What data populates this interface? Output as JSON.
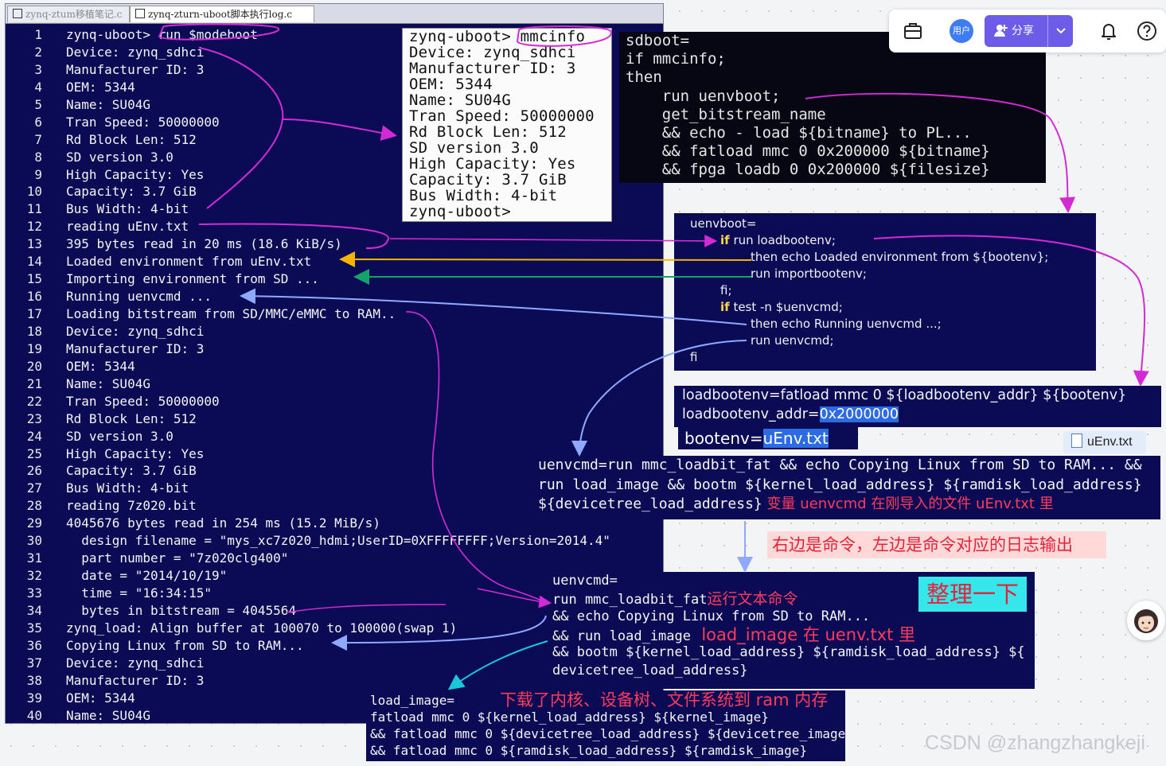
{
  "tabs": [
    {
      "label": "zynq-ztum移植笔记.c"
    },
    {
      "label": "zynq-zturn-uboot脚本执行log.c"
    }
  ],
  "log_lines": [
    {
      "n": "1",
      "t": "zynq-uboot> run $modeboot"
    },
    {
      "n": "2",
      "t": "Device: zynq_sdhci"
    },
    {
      "n": "3",
      "t": "Manufacturer ID: 3"
    },
    {
      "n": "4",
      "t": "OEM: 5344"
    },
    {
      "n": "5",
      "t": "Name: SU04G"
    },
    {
      "n": "6",
      "t": "Tran Speed: 50000000"
    },
    {
      "n": "7",
      "t": "Rd Block Len: 512"
    },
    {
      "n": "8",
      "t": "SD version 3.0"
    },
    {
      "n": "9",
      "t": "High Capacity: Yes"
    },
    {
      "n": "10",
      "t": "Capacity: 3.7 GiB"
    },
    {
      "n": "11",
      "t": "Bus Width: 4-bit"
    },
    {
      "n": "12",
      "t": "reading uEnv.txt"
    },
    {
      "n": "13",
      "t": "395 bytes read in 20 ms (18.6 KiB/s)"
    },
    {
      "n": "14",
      "t": "Loaded environment from uEnv.txt"
    },
    {
      "n": "15",
      "t": "Importing environment from SD ..."
    },
    {
      "n": "16",
      "t": "Running uenvcmd ..."
    },
    {
      "n": "17",
      "t": "Loading bitstream from SD/MMC/eMMC to RAM.."
    },
    {
      "n": "18",
      "t": "Device: zynq_sdhci"
    },
    {
      "n": "19",
      "t": "Manufacturer ID: 3"
    },
    {
      "n": "20",
      "t": "OEM: 5344"
    },
    {
      "n": "21",
      "t": "Name: SU04G"
    },
    {
      "n": "22",
      "t": "Tran Speed: 50000000"
    },
    {
      "n": "23",
      "t": "Rd Block Len: 512"
    },
    {
      "n": "24",
      "t": "SD version 3.0"
    },
    {
      "n": "25",
      "t": "High Capacity: Yes"
    },
    {
      "n": "26",
      "t": "Capacity: 3.7 GiB"
    },
    {
      "n": "27",
      "t": "Bus Width: 4-bit"
    },
    {
      "n": "28",
      "t": "reading 7z020.bit"
    },
    {
      "n": "29",
      "t": "4045676 bytes read in 254 ms (15.2 MiB/s)"
    },
    {
      "n": "30",
      "t": "  design filename = \"mys_xc7z020_hdmi;UserID=0XFFFFFFFF;Version=2014.4\""
    },
    {
      "n": "31",
      "t": "  part number = \"7z020clg400\""
    },
    {
      "n": "32",
      "t": "  date = \"2014/10/19\""
    },
    {
      "n": "33",
      "t": "  time = \"16:34:15\""
    },
    {
      "n": "34",
      "t": "  bytes in bitstream = 4045564"
    },
    {
      "n": "35",
      "t": "zynq_load: Align buffer at 100070 to 100000(swap 1)"
    },
    {
      "n": "36",
      "t": "Copying Linux from SD to RAM..."
    },
    {
      "n": "37",
      "t": "Device: zynq_sdhci"
    },
    {
      "n": "38",
      "t": "Manufacturer ID: 3"
    },
    {
      "n": "39",
      "t": "OEM: 5344"
    },
    {
      "n": "40",
      "t": "Name: SU04G"
    }
  ],
  "mmcinfo_lines": [
    "zynq-uboot> mmcinfo",
    "Device: zynq_sdhci",
    "Manufacturer ID: 3",
    "OEM: 5344",
    "Name: SU04G",
    "Tran Speed: 50000000",
    "Rd Block Len: 512",
    "SD version 3.0",
    "High Capacity: Yes",
    "Capacity: 3.7 GiB",
    "Bus Width: 4-bit",
    "zynq-uboot>"
  ],
  "sdboot_lines": [
    "sdboot=",
    "if mmcinfo;",
    "then",
    "    run uenvboot;",
    "    get_bitstream_name",
    "    && echo - load ${bitname} to PL...",
    "    && fatload mmc 0 0x200000 ${bitname}",
    "    && fpga loadb 0 0x200000 ${filesize}"
  ],
  "uenvboot_lines": [
    {
      "kw": "",
      "t": "uenvboot=",
      "indent": "0"
    },
    {
      "kw": "if",
      "t": " run loadbootenv;",
      "indent": "1"
    },
    {
      "kw": "",
      "t": "then echo Loaded environment from ${bootenv};",
      "indent": "2"
    },
    {
      "kw": "",
      "t": "run importbootenv;",
      "indent": "2"
    },
    {
      "kw": "",
      "t": "fi;",
      "indent": "1"
    },
    {
      "kw": "if",
      "t": " test -n $uenvcmd;",
      "indent": "1"
    },
    {
      "kw": "",
      "t": "then echo Running uenvcmd ...;",
      "indent": "2"
    },
    {
      "kw": "",
      "t": "run uenvcmd;",
      "indent": "2"
    },
    {
      "kw": "",
      "t": "fi",
      "indent": "0b"
    }
  ],
  "loadbootenv": {
    "line1": "loadbootenv=fatload mmc 0 ${loadbootenv_addr} ${bootenv}",
    "line2_prefix": "loadbootenv_addr=",
    "line2_value": "0x2000000",
    "bootenv_prefix": "bootenv=",
    "bootenv_value": "uEnv.txt"
  },
  "uenv_file_tag": "uEnv.txt",
  "uenvcmd_box": {
    "line1": "uenvcmd=run mmc_loadbit_fat && echo Copying Linux from SD to RAM... &&",
    "line2": "run load_image && bootm ${kernel_load_address} ${ramdisk_load_address}",
    "line3": "${devicetree_load_address}",
    "note": " 变量 uenvcmd 在刚导入的文件 uEnv.txt 里"
  },
  "note_commands": "右边是命令，左边是命令对应的日志输出",
  "note_summary": "整理一下",
  "uenvcmd_explained": {
    "line1": "uenvcmd=",
    "line2": "run mmc_loadbit_fat",
    "line2_note": "运行文本命令",
    "line3": "&& echo Copying Linux from SD to RAM...",
    "line4": "&& run load_image",
    "line4_note": "  load_image 在 uenv.txt 里",
    "line5": "&& bootm ${kernel_load_address} ${ramdisk_load_address} ${",
    "line6": "devicetree_load_address}"
  },
  "load_image": {
    "line1": "load_image=",
    "line2": "fatload mmc 0 ${kernel_load_address} ${kernel_image}",
    "line3": "&& fatload mmc 0 ${devicetree_load_address} ${devicetree_image}",
    "line4": "&& fatload mmc 0 ${ramdisk_load_address} ${ramdisk_image}",
    "note": "下载了内核、设备树、文件系统到 ram 内存"
  },
  "toolbar": {
    "user_label": "用户",
    "share_label": "分享",
    "icons": [
      "briefcase-icon",
      "user-avatar",
      "share-icon",
      "chevron-down-icon",
      "bell-icon",
      "help-icon"
    ]
  },
  "watermark": "CSDN @zhangzhangkeji",
  "colors": {
    "terminal_bg": "#0b0b55",
    "dark_bg": "#070714",
    "annotation_magenta": "#d42ad6",
    "annotation_orange": "#f5b400",
    "annotation_green": "#14a36b",
    "annotation_blue": "#8fa9ff",
    "annotation_cyan": "#18c7d8",
    "share_purple": "#6c5ce7",
    "red_note": "#ff3b5c"
  }
}
